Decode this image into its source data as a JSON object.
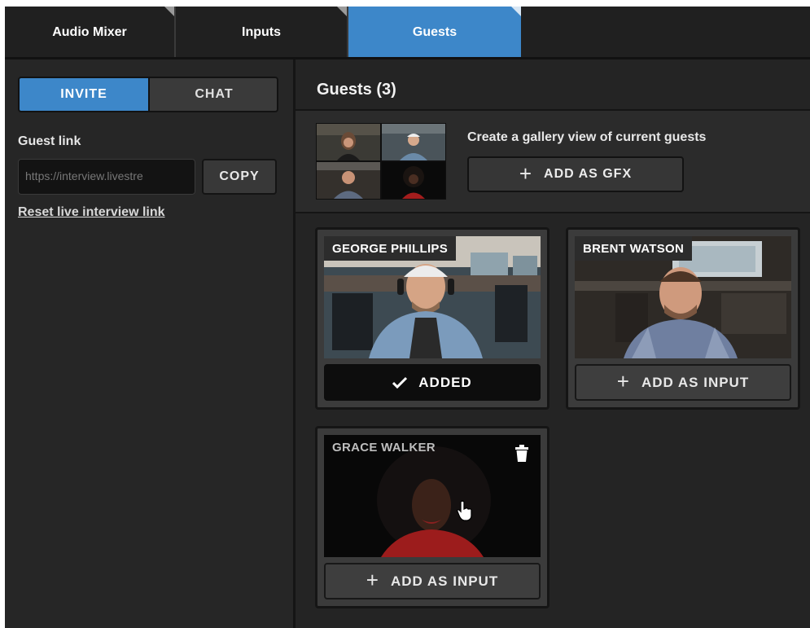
{
  "tabs": [
    {
      "label": "Audio Mixer",
      "active": false
    },
    {
      "label": "Inputs",
      "active": false
    },
    {
      "label": "Guests",
      "active": true
    }
  ],
  "left_panel": {
    "segment": {
      "invite": "INVITE",
      "chat": "CHAT",
      "selected": "INVITE"
    },
    "guest_link_label": "Guest link",
    "guest_link_value": "https://interview.livestre",
    "copy_label": "COPY",
    "reset_link_label": "Reset live interview link"
  },
  "main": {
    "title": "Guests (3)",
    "gallery": {
      "caption": "Create a gallery view of current guests",
      "button_label": "ADD AS GFX"
    },
    "guests": [
      {
        "name": "GEORGE PHILLIPS",
        "button_label": "ADDED",
        "status": "added"
      },
      {
        "name": "BRENT WATSON",
        "button_label": "ADD AS INPUT",
        "status": "available"
      },
      {
        "name": "GRACE WALKER",
        "button_label": "ADD AS INPUT",
        "status": "available"
      }
    ]
  },
  "colors": {
    "accent": "#3d87c9",
    "panel": "#242424",
    "sidebar": "#262626",
    "button": "#3e3e3e",
    "added_button": "#0d0d0d"
  },
  "icons": {
    "plus": "plus-icon",
    "check": "check-icon",
    "trash": "trash-icon",
    "cursor": "hand-cursor-icon"
  }
}
